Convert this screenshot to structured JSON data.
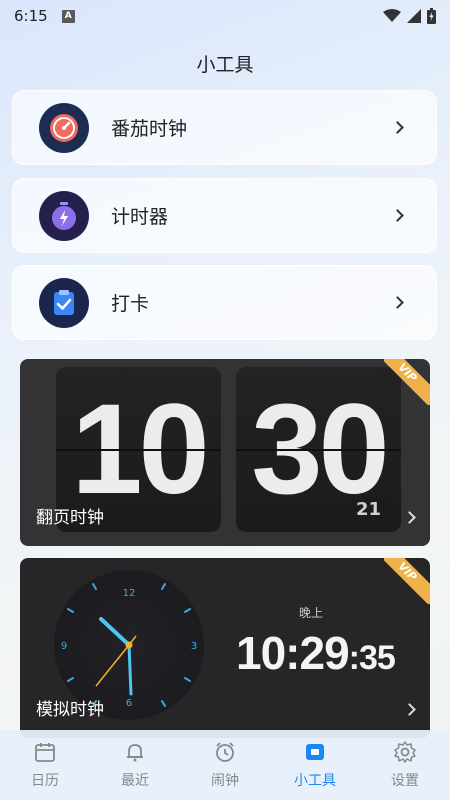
{
  "status_bar": {
    "time": "6:15",
    "notification_letter": "A"
  },
  "page_title": "小工具",
  "tools": [
    {
      "label": "番茄时钟",
      "icon": "pomodoro-icon"
    },
    {
      "label": "计时器",
      "icon": "stopwatch-icon"
    },
    {
      "label": "打卡",
      "icon": "checkin-icon"
    }
  ],
  "flip_clock": {
    "hours": "10",
    "minutes": "30",
    "seconds": "21",
    "label": "翻页时钟",
    "badge": "VIP"
  },
  "analog_clock": {
    "label": "模拟时钟",
    "badge": "VIP",
    "period": "晚上",
    "hour": "10",
    "minute": "29",
    "second": "35",
    "dial_numbers": [
      "12",
      "3",
      "6",
      "9"
    ]
  },
  "bottom_nav": [
    {
      "label": "日历",
      "icon": "calendar-icon",
      "active": false
    },
    {
      "label": "最近",
      "icon": "bell-icon",
      "active": false
    },
    {
      "label": "闹钟",
      "icon": "alarm-clock-icon",
      "active": false
    },
    {
      "label": "小工具",
      "icon": "widget-tools-icon",
      "active": true
    },
    {
      "label": "设置",
      "icon": "gear-icon",
      "active": false
    }
  ],
  "colors": {
    "accent": "#1c86f2",
    "vip": "#efb24b",
    "inactive_nav": "#888888"
  }
}
